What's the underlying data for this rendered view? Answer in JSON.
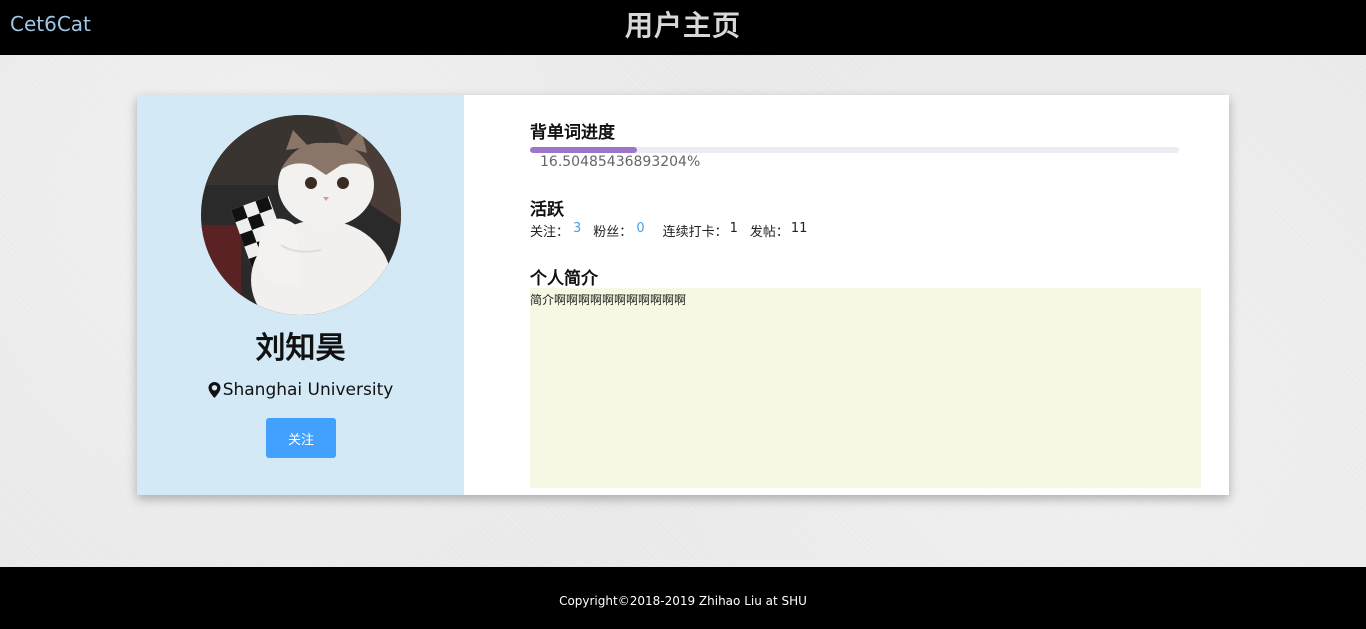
{
  "header": {
    "brand": "Cet6Cat",
    "title": "用户主页"
  },
  "profile": {
    "name": "刘知昊",
    "location": "Shanghai University",
    "follow_label": "关注",
    "avatar_icon": "cat-photo-avatar"
  },
  "progress": {
    "title": "背单词进度",
    "percent": 16.50485436893204,
    "percent_text": "16.50485436893204%",
    "fill_color": "#9c77c9"
  },
  "activity": {
    "title": "活跃",
    "following_label": "关注：",
    "following_count": "3",
    "followers_label": "粉丝：",
    "followers_count": "0",
    "streak_label": "连续打卡：",
    "streak_count": "1",
    "posts_label": "发帖：",
    "posts_count": "11"
  },
  "bio": {
    "title": "个人简介",
    "text": "简介啊啊啊啊啊啊啊啊啊啊啊"
  },
  "footer": {
    "copyright": "Copyright©2018-2019 Zhihao Liu at SHU"
  },
  "colors": {
    "accent": "#42a0ff",
    "link": "#4aa0e8",
    "left_panel": "#d3e9f5",
    "bio_bg": "#f6f8e3"
  }
}
